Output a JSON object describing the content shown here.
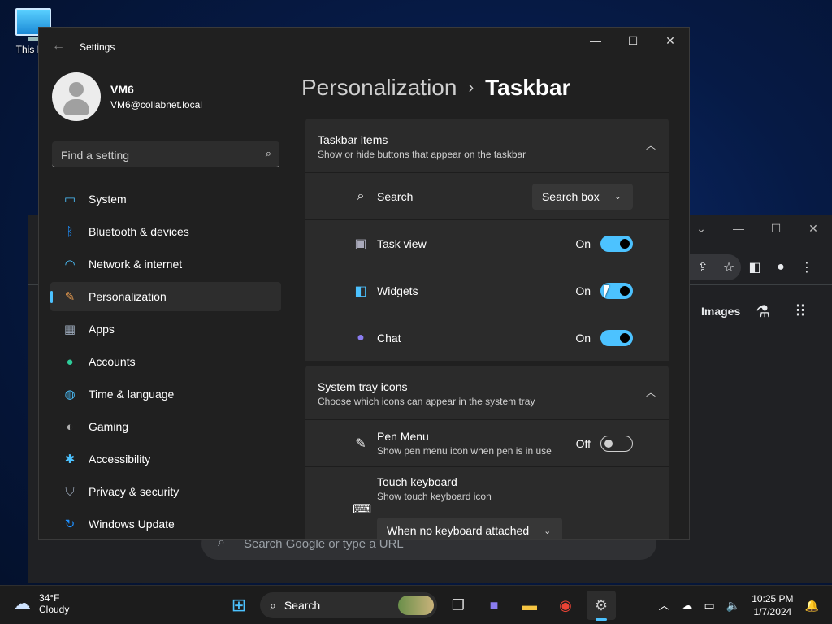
{
  "desktop": {
    "icon_label": "This PC"
  },
  "browser": {
    "images_link": "Images",
    "search_placeholder": "Search Google or type a URL"
  },
  "settings": {
    "window_title": "Settings",
    "user": {
      "name": "VM6",
      "email": "VM6@collabnet.local"
    },
    "search_placeholder": "Find a setting",
    "nav": [
      {
        "label": "System",
        "icon": "system-icon",
        "color": "#4cc2ff"
      },
      {
        "label": "Bluetooth & devices",
        "icon": "bluetooth-icon",
        "color": "#1e90ff"
      },
      {
        "label": "Network & internet",
        "icon": "wifi-icon",
        "color": "#4cc2ff"
      },
      {
        "label": "Personalization",
        "icon": "brush-icon",
        "color": "#f0a050",
        "active": true
      },
      {
        "label": "Apps",
        "icon": "apps-icon",
        "color": "#9aa7b8"
      },
      {
        "label": "Accounts",
        "icon": "accounts-icon",
        "color": "#2ecc9a"
      },
      {
        "label": "Time & language",
        "icon": "globe-clock-icon",
        "color": "#4cc2ff"
      },
      {
        "label": "Gaming",
        "icon": "gamepad-icon",
        "color": "#b0b0b0"
      },
      {
        "label": "Accessibility",
        "icon": "accessibility-icon",
        "color": "#4cc2ff"
      },
      {
        "label": "Privacy & security",
        "icon": "shield-icon",
        "color": "#9aa7b8"
      },
      {
        "label": "Windows Update",
        "icon": "update-icon",
        "color": "#1e90ff"
      }
    ],
    "breadcrumb": {
      "parent": "Personalization",
      "current": "Taskbar"
    },
    "taskbar_items": {
      "title": "Taskbar items",
      "subtitle": "Show or hide buttons that appear on the taskbar",
      "search": {
        "label": "Search",
        "value": "Search box"
      },
      "task_view": {
        "label": "Task view",
        "state": "On"
      },
      "widgets": {
        "label": "Widgets",
        "state": "On"
      },
      "chat": {
        "label": "Chat",
        "state": "On"
      }
    },
    "system_tray": {
      "title": "System tray icons",
      "subtitle": "Choose which icons can appear in the system tray",
      "pen_menu": {
        "label": "Pen Menu",
        "desc": "Show pen menu icon when pen is in use",
        "state": "Off"
      },
      "touch_keyboard": {
        "label": "Touch keyboard",
        "desc": "Show touch keyboard icon",
        "value": "When no keyboard attached"
      }
    }
  },
  "taskbar": {
    "weather": {
      "temp": "34°F",
      "condition": "Cloudy"
    },
    "search_label": "Search",
    "clock": {
      "time": "10:25 PM",
      "date": "1/7/2024"
    }
  },
  "accent_color": "#4cc2ff"
}
